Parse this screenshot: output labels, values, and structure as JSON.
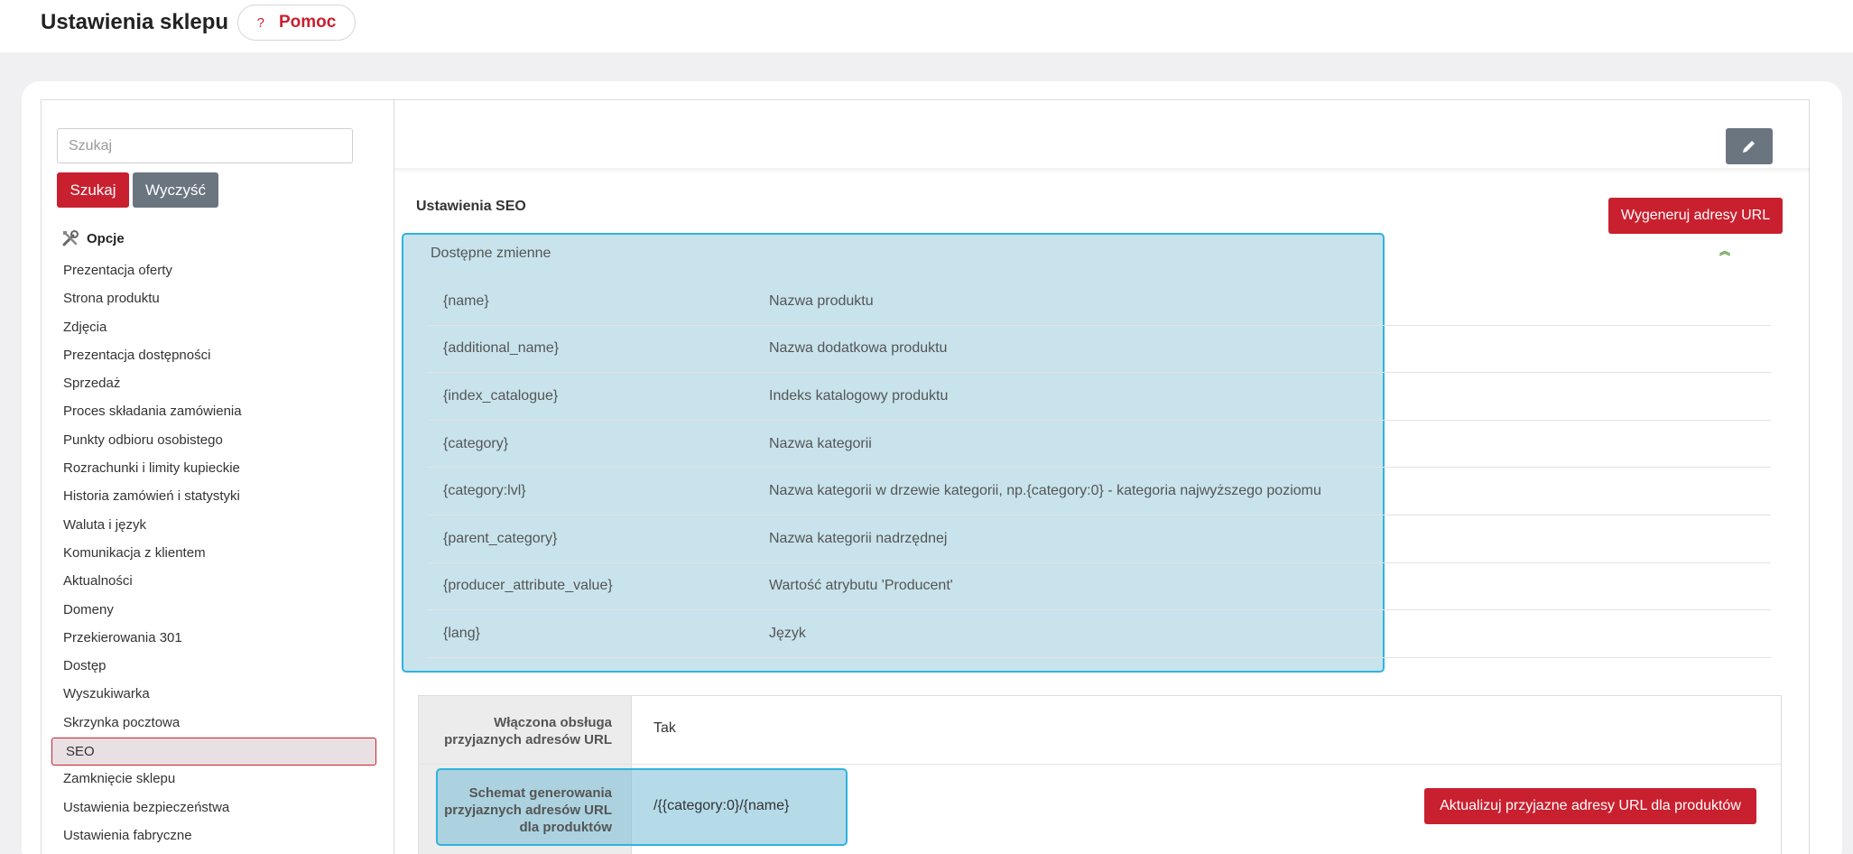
{
  "header": {
    "title": "Ustawienia sklepu",
    "help_icon": "?",
    "help_label": "Pomoc"
  },
  "sidebar": {
    "search_placeholder": "Szukaj",
    "search_button": "Szukaj",
    "clear_button": "Wyczyść",
    "section_title": "Opcje",
    "items": [
      "Prezentacja oferty",
      "Strona produktu",
      "Zdjęcia",
      "Prezentacja dostępności",
      "Sprzedaż",
      "Proces składania zamówienia",
      "Punkty odbioru osobistego",
      "Rozrachunki i limity kupieckie",
      "Historia zamówień i statystyki",
      "Waluta i język",
      "Komunikacja z klientem",
      "Aktualności",
      "Domeny",
      "Przekierowania 301",
      "Dostęp",
      "Wyszukiwarka",
      "Skrzynka pocztowa",
      "SEO",
      "Zamknięcie sklepu",
      "Ustawienia bezpieczeństwa",
      "Ustawienia fabryczne"
    ],
    "active_item": "SEO"
  },
  "main": {
    "section_title": "Ustawienia SEO",
    "generate_button": "Wygeneruj adresy URL",
    "collapse_icon": "chevron-double-up-icon",
    "edit_icon": "pencil-icon",
    "variables_title": "Dostępne zmienne",
    "variables": [
      {
        "key": "{name}",
        "desc": "Nazwa produktu"
      },
      {
        "key": "{additional_name}",
        "desc": "Nazwa dodatkowa produktu"
      },
      {
        "key": "{index_catalogue}",
        "desc": "Indeks katalogowy produktu"
      },
      {
        "key": "{category}",
        "desc": "Nazwa kategorii"
      },
      {
        "key": "{category:lvl}",
        "desc": "Nazwa kategorii w drzewie kategorii, np.{category:0} - kategoria najwyższego poziomu"
      },
      {
        "key": "{parent_category}",
        "desc": "Nazwa kategorii nadrzędnej"
      },
      {
        "key": "{producer_attribute_value}",
        "desc": "Wartość atrybutu 'Producent'"
      },
      {
        "key": "{lang}",
        "desc": "Język"
      }
    ],
    "settings": [
      {
        "label_line1": "Włączona obsługa",
        "label_line2": "przyjaznych adresów URL",
        "value": "Tak"
      },
      {
        "label_line1": "Schemat generowania",
        "label_line2": "przyjaznych adresów URL",
        "label_line3": "dla produktów",
        "value": "/{{category:0}/{name}"
      }
    ],
    "update_button": "Aktualizuj przyjazne adresy URL dla produktów"
  },
  "colors": {
    "accent": "#c9202f",
    "secondary": "#6b7580",
    "highlight": "#2fb3e0"
  }
}
